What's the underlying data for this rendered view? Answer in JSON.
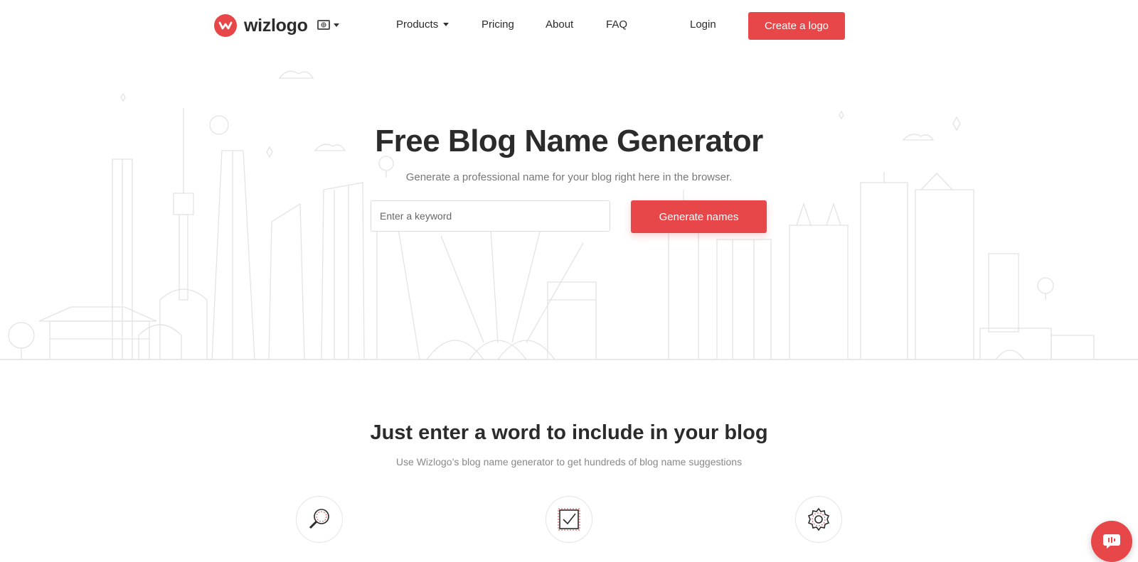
{
  "brand": {
    "name": "wizlogo",
    "accent": "#e8474a"
  },
  "nav": {
    "products": "Products",
    "pricing": "Pricing",
    "about": "About",
    "faq": "FAQ",
    "login": "Login",
    "create_logo": "Create a logo"
  },
  "hero": {
    "title": "Free Blog Name Generator",
    "subtitle": "Generate a professional name for your blog right here in the browser.",
    "keyword_placeholder": "Enter a keyword",
    "keyword_value": "",
    "generate_button": "Generate names"
  },
  "section": {
    "title": "Just enter a word to include in your blog",
    "subtitle": "Use Wizlogo’s blog name generator to get hundreds of blog name suggestions"
  },
  "features": [
    {
      "icon": "magnifier-icon"
    },
    {
      "icon": "checkbox-icon"
    },
    {
      "icon": "gear-icon"
    }
  ],
  "chat": {
    "icon": "chat-icon"
  }
}
